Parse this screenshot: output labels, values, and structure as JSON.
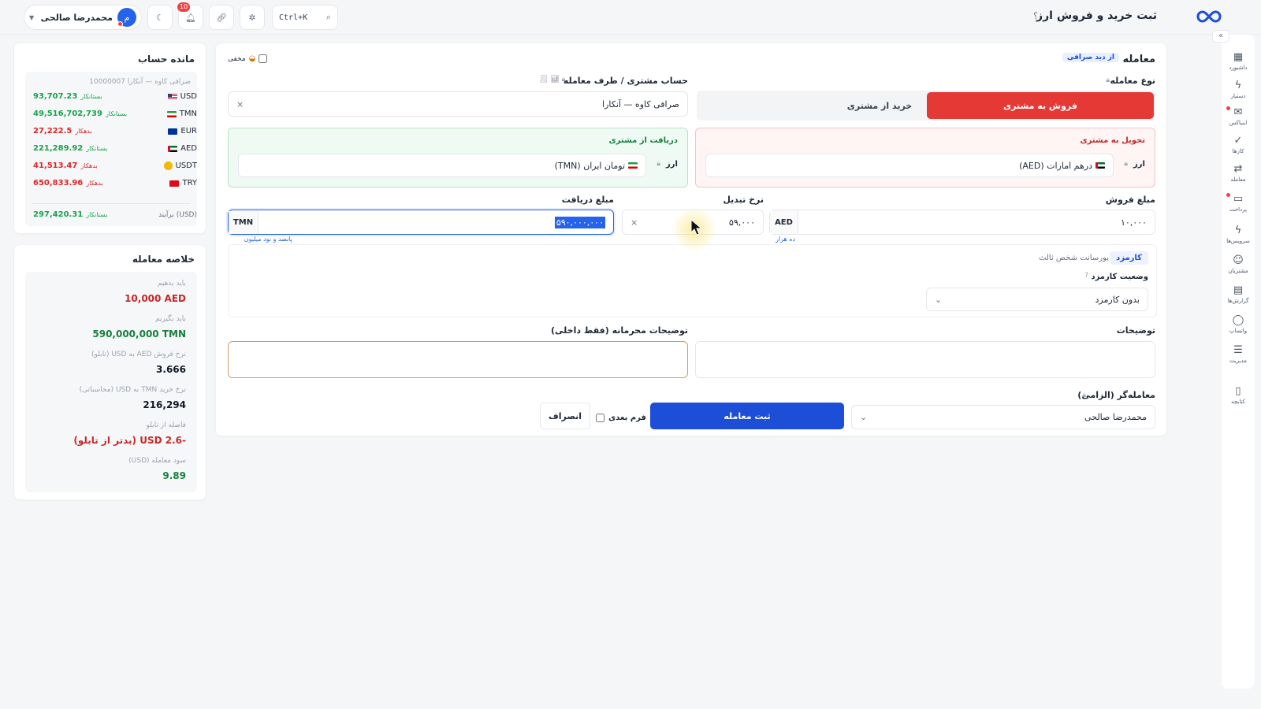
{
  "header": {
    "title": "ثبت خرید و فروش ارز",
    "help": "؟",
    "user_name": "محمدرضا صالحی",
    "user_initial": "م",
    "notif_count": "10",
    "search_shortcut": "Ctrl+K"
  },
  "rail": {
    "collapse": "«",
    "items": [
      {
        "label": "داشبورد",
        "icon": "dashboard-icon"
      },
      {
        "label": "دستیار",
        "icon": "bolt-icon"
      },
      {
        "label": "اینباکس",
        "icon": "inbox-icon"
      },
      {
        "label": "کارها",
        "icon": "check-icon"
      },
      {
        "label": "معامله",
        "icon": "exchange-icon"
      },
      {
        "label": "پرداخت",
        "icon": "payment-icon"
      },
      {
        "label": "سرویس‌ها",
        "icon": "services-icon"
      },
      {
        "label": "مشتریان",
        "icon": "customers-icon"
      },
      {
        "label": "گزارش‌ها",
        "icon": "reports-icon"
      },
      {
        "label": "واتساپ",
        "icon": "whatsapp-icon"
      },
      {
        "label": "مدیریت",
        "icon": "settings-icon"
      },
      {
        "label": "کتابچه",
        "icon": "book-icon"
      }
    ]
  },
  "trade": {
    "title": "معامله",
    "view_badge": "از دید صرافی",
    "hidden_label": "مخفی",
    "type_label": "نوع معامله",
    "sell_btn": "فروش به مشتری",
    "buy_btn": "خرید از مشتری",
    "account_label": "حساب مشتری / طرف معامله",
    "account_value": "صرافی کاوه — آنکارا",
    "deliver_title": "تحویل به مشتری",
    "receive_title": "دریافت از مشتری",
    "currency_label": "ارز",
    "deliver_currency": "درهم امارات (AED)",
    "receive_currency": "تومان ایران (TMN)",
    "sell_amount_label": "مبلغ فروش",
    "sell_amount": "۱۰,۰۰۰",
    "sell_unit": "AED",
    "sell_words": "ده هزار",
    "rate_label": "نرخ تبدیل",
    "rate_value": "۵۹,۰۰۰",
    "rate_op": "×",
    "receive_amount_label": "مبلغ دریافت",
    "receive_amount": "۵۹۰,۰۰۰,۰۰۰",
    "receive_unit": "TMN",
    "receive_words": "پانصد و نود میلیون",
    "fee_tab": "کارمزد",
    "fee_tab2": "پورسانت شخص ثالث",
    "fee_status_label": "وضعیت کارمزد",
    "fee_status_value": "بدون کارمزد",
    "notes_label": "توضیحات",
    "private_notes_label": "توضیحات محرمانه (فقط داخلی)",
    "trader_label": "معامله‌گر (الزامی)",
    "trader_value": "محمدرضا صالحی",
    "submit_btn": "ثبت معامله",
    "next_form_label": "فرم بعدی",
    "cancel_btn": "انصراف"
  },
  "balance": {
    "title": "مانده حساب",
    "account": "صرافی کاوه — آنکارا 10000007",
    "rows": [
      {
        "cur": "USD",
        "flag": "us",
        "status": "بستانکار",
        "value": "93,707.23",
        "color": "green"
      },
      {
        "cur": "TMN",
        "flag": "ir",
        "status": "بستانکار",
        "value": "49,516,702,739",
        "color": "green"
      },
      {
        "cur": "EUR",
        "flag": "eu",
        "status": "بدهکار",
        "value": "27,222.5",
        "color": "red"
      },
      {
        "cur": "AED",
        "flag": "ae",
        "status": "بستانکار",
        "value": "221,289.92",
        "color": "green"
      },
      {
        "cur": "USDT",
        "flag": "coin",
        "status": "بدهکار",
        "value": "41,513.47",
        "color": "red"
      },
      {
        "cur": "TRY",
        "flag": "tr",
        "status": "بدهکار",
        "value": "650,833.96",
        "color": "red"
      }
    ],
    "total_label": "برآیند (USD)",
    "total_status": "بستانکار",
    "total_value": "297,420.31"
  },
  "summary": {
    "title": "خلاصه معامله",
    "items": [
      {
        "label": "باید بدهیم",
        "value": "10,000 AED",
        "color": "red"
      },
      {
        "label": "باید بگیریم",
        "value": "590,000,000 TMN",
        "color": "green"
      },
      {
        "label": "نرخ فروش AED به USD (تابلو)",
        "value": "3.666",
        "color": "dark"
      },
      {
        "label": "نرخ خرید TMN به USD (محاسباتی)",
        "value": "216,294",
        "color": "dark"
      },
      {
        "label": "فاصله از تابلو",
        "value": "-2.6 USD (بدتر از تابلو)",
        "color": "red"
      },
      {
        "label": "سود معامله (USD)",
        "value": "9.89",
        "color": "green"
      }
    ]
  },
  "colors": {
    "primary": "#1d4ed8",
    "danger": "#e53935",
    "success": "#16a34a"
  }
}
